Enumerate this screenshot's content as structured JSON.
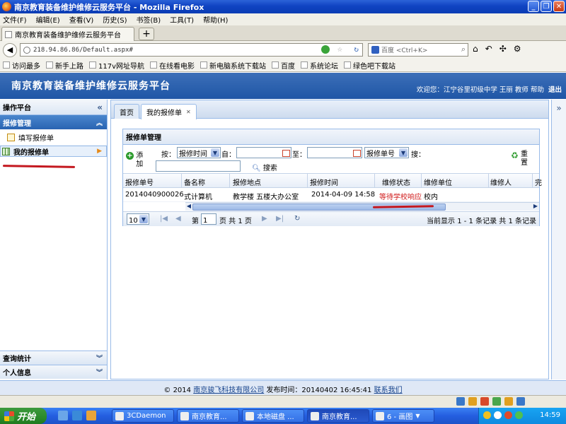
{
  "window": {
    "title": "南京教育装备维护维修云服务平台 - Mozilla Firefox"
  },
  "menu": [
    "文件(F)",
    "编辑(E)",
    "查看(V)",
    "历史(S)",
    "书签(B)",
    "工具(T)",
    "帮助(H)"
  ],
  "browser_tab": {
    "label": "南京教育装备维护维修云服务平台",
    "new_tab": "+"
  },
  "nav": {
    "url": "218.94.86.86/Default.aspx#",
    "search_placeholder": "百度 <Ctrl+K>"
  },
  "bookmarks": [
    "访问最多",
    "新手上路",
    "117v网址导航",
    "在线看电影",
    "新电脑系统下载站",
    "百度",
    "系统论坛",
    "绿色吧下载站"
  ],
  "header": {
    "title": "南京教育装备维护维修云服务平台",
    "welcome": "欢迎您：江宁谷里初级中学 王丽 教师",
    "help": "帮助",
    "logout": "退出"
  },
  "sidebar": {
    "title": "操作平台",
    "section": "报修管理",
    "items": [
      "填写报修单",
      "我的报修单"
    ],
    "footer_items": [
      "查询统计",
      "个人信息"
    ]
  },
  "tabs": [
    "首页",
    "我的报修单"
  ],
  "grid": {
    "title": "报修单管理",
    "add_label": "添加",
    "by_label": "按：",
    "field1": "报修时间",
    "from_label": "自：",
    "to_label": "至：",
    "field2": "报修单号",
    "search_label": "搜：",
    "search_button": "搜索",
    "reset_label": "重置",
    "columns": [
      "报修单号",
      "备名称",
      "报修地点",
      "报修时间",
      "维修状态",
      "维修单位",
      "维修人",
      "完"
    ],
    "rows": [
      {
        "id": "2014040900026",
        "name": "式计算机",
        "location": "教学楼 五楼大办公室",
        "time": "2014-04-09 14:58",
        "status": "等待学校响应",
        "unit": "校内",
        "person": ""
      }
    ],
    "pager": {
      "page_size": "10",
      "page_prefix": "第",
      "page": "1",
      "page_suffix": "页 共 1 页",
      "info": "当前显示 1 - 1 条记录 共 1 条记录"
    }
  },
  "footer": {
    "copyright": "© 2014",
    "company": "南京骏飞科技有限公司",
    "release": "发布时间：20140402 16:45:41",
    "contact": "联系我们"
  },
  "taskbar": {
    "start": "开始",
    "tasks": [
      "3CDaemon",
      "南京教育...",
      "本地磁盘 ...",
      "南京教育...",
      "6 - 画图"
    ],
    "clock": "14:59"
  }
}
